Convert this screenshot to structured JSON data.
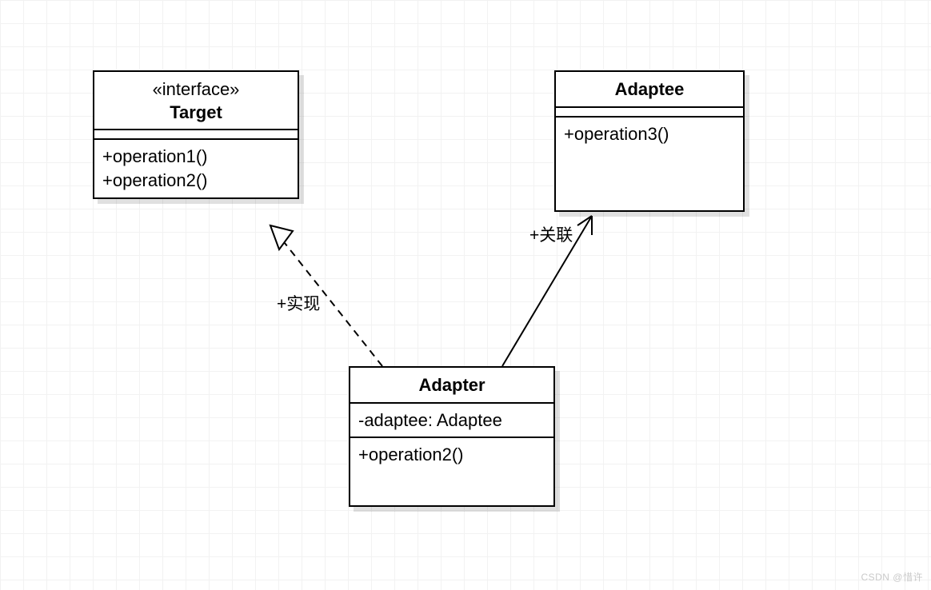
{
  "boxes": {
    "target": {
      "stereotype": "«interface»",
      "name": "Target",
      "methods": [
        "+operation1()",
        "+operation2()"
      ]
    },
    "adaptee": {
      "name": "Adaptee",
      "methods": [
        "+operation3()"
      ]
    },
    "adapter": {
      "name": "Adapter",
      "attributes": [
        "-adaptee: Adaptee"
      ],
      "methods": [
        "+operation2()"
      ]
    }
  },
  "edges": {
    "realize": {
      "label": "+实现"
    },
    "assoc": {
      "label": "+关联"
    }
  },
  "watermark": "CSDN @惜许"
}
